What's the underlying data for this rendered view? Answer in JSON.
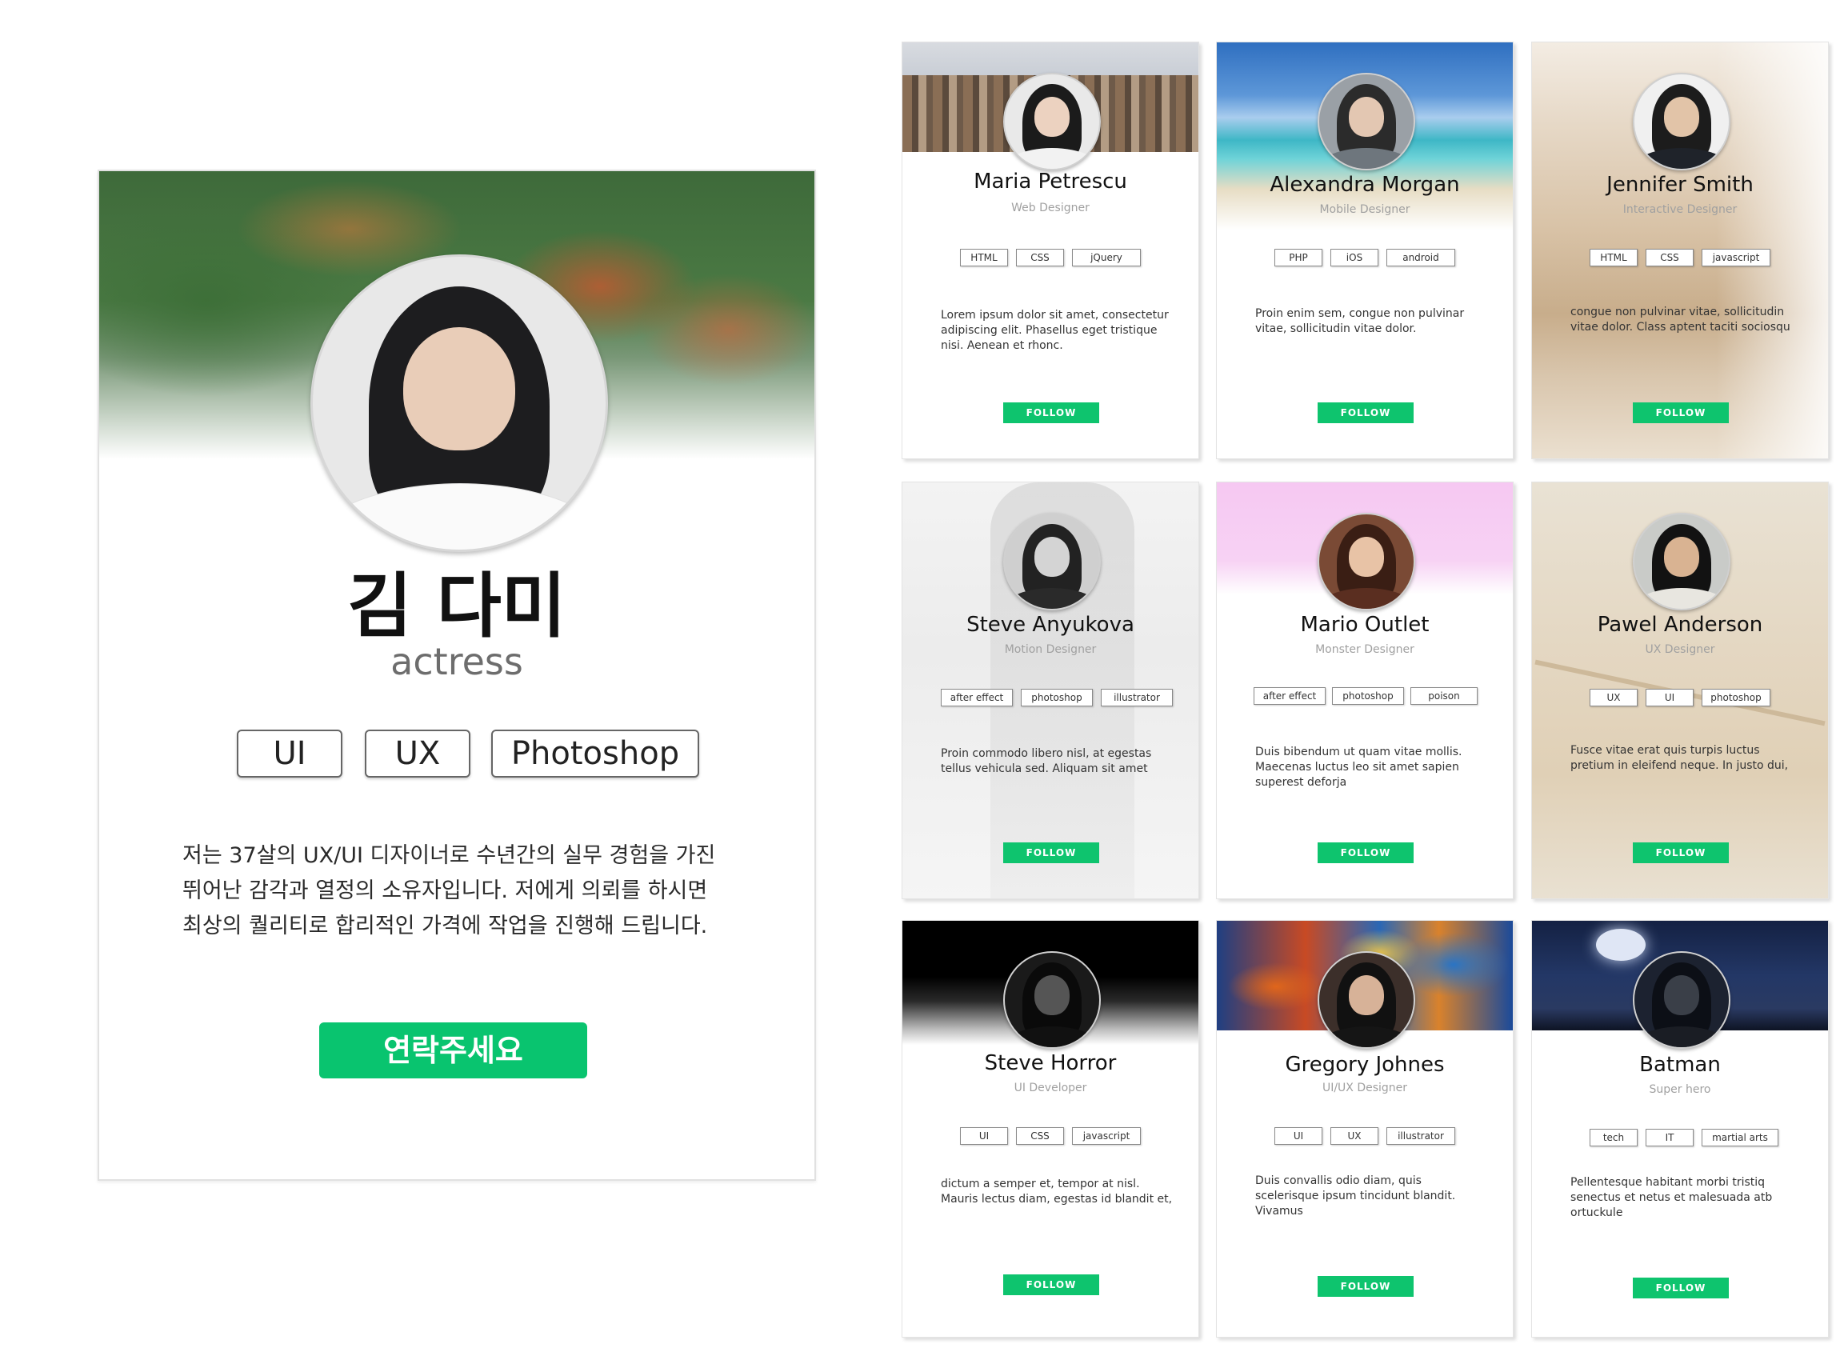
{
  "featured": {
    "name": "김 다미",
    "role": "actress",
    "tags": [
      "UI",
      "UX",
      "Photoshop"
    ],
    "description_lines": [
      "저는 37살의 UX/UI 디자이너로 수년간의 실무 경험을 가진",
      "뛰어난 감각과 열정의 소유자입니다. 저에게 의뢰를 하시면",
      "최상의 퀄리티로 합리적인 가격에 작업을 진행해 드립니다."
    ],
    "button_label": "연락주세요",
    "accent_color": "#09c46f"
  },
  "cards": [
    {
      "name": "Maria Petrescu",
      "role": "Web Designer",
      "tags": [
        "HTML",
        "CSS",
        "jQuery"
      ],
      "description": "Lorem ipsum dolor sit amet, consectetur adipiscing elit. Phasellus eget tristique nisi. Aenean et rhonc.",
      "follow": "FOLLOW"
    },
    {
      "name": "Alexandra Morgan",
      "role": "Mobile Designer",
      "tags": [
        "PHP",
        "iOS",
        "android"
      ],
      "description": "Proin enim sem, congue non pulvinar vitae, sollicitudin vitae dolor.",
      "follow": "FOLLOW"
    },
    {
      "name": "Jennifer Smith",
      "role": "Interactive Designer",
      "tags": [
        "HTML",
        "CSS",
        "javascript"
      ],
      "description": "congue non pulvinar vitae, sollicitudin vitae dolor. Class aptent taciti sociosqu",
      "follow": "FOLLOW"
    },
    {
      "name": "Steve Anyukova",
      "role": "Motion Designer",
      "tags": [
        "after effect",
        "photoshop",
        "illustrator"
      ],
      "description": "Proin commodo libero nisl, at egestas tellus vehicula sed. Aliquam sit amet",
      "follow": "FOLLOW"
    },
    {
      "name": "Mario Outlet",
      "role": "Monster Designer",
      "tags": [
        "after effect",
        "photoshop",
        "poison"
      ],
      "description": "Duis bibendum ut quam vitae mollis. Maecenas luctus leo sit amet sapien superest deforja",
      "follow": "FOLLOW"
    },
    {
      "name": "Pawel Anderson",
      "role": "UX Designer",
      "tags": [
        "UX",
        "UI",
        "photoshop"
      ],
      "description": "Fusce vitae erat quis turpis luctus pretium in eleifend neque. In justo dui,",
      "follow": "FOLLOW"
    },
    {
      "name": "Steve Horror",
      "role": "UI Developer",
      "tags": [
        "UI",
        "CSS",
        "javascript"
      ],
      "description": "dictum a semper et, tempor at nisl. Mauris lectus diam, egestas id blandit et,",
      "follow": "FOLLOW"
    },
    {
      "name": "Gregory Johnes",
      "role": "UI/UX Designer",
      "tags": [
        "UI",
        "UX",
        "illustrator"
      ],
      "description": "Duis convallis odio diam, quis scelerisque ipsum tincidunt blandit. Vivamus",
      "follow": "FOLLOW"
    },
    {
      "name": "Batman",
      "role": "Super hero",
      "tags": [
        "tech",
        "IT",
        "martial arts"
      ],
      "description": "Pellentesque habitant morbi tristiq senectus et netus et malesuada atb ortuckule",
      "follow": "FOLLOW"
    }
  ]
}
